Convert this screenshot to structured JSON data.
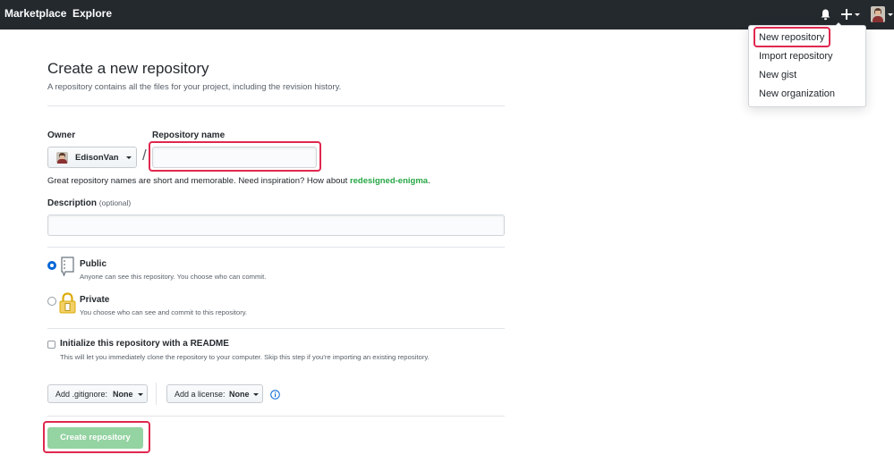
{
  "header": {
    "nav": [
      "Marketplace",
      "Explore"
    ],
    "icons": [
      "bell-icon",
      "plus-icon",
      "avatar"
    ]
  },
  "dropdown": {
    "items": [
      "New repository",
      "Import repository",
      "New gist",
      "New organization"
    ]
  },
  "page": {
    "title": "Create a new repository",
    "subtitle": "A repository contains all the files for your project, including the revision history."
  },
  "form": {
    "owner_label": "Owner",
    "repo_name_label": "Repository name",
    "owner_value": "EdisonVan",
    "slash": "/",
    "repo_name_value": "",
    "hint_prefix": "Great repository names are short and memorable. Need inspiration? How about",
    "hint_suggestion": "redesigned-enigma",
    "hint_suffix": ".",
    "description_label": "Description",
    "description_optional": "(optional)",
    "description_value": "",
    "visibility": [
      {
        "label": "Public",
        "desc": "Anyone can see this repository. You choose who can commit.",
        "selected": true
      },
      {
        "label": "Private",
        "desc": "You choose who can see and commit to this repository.",
        "selected": false
      }
    ],
    "readme_label": "Initialize this repository with a README",
    "readme_desc": "This will let you immediately clone the repository to your computer. Skip this step if you're importing an existing repository.",
    "readme_checked": false,
    "gitignore_prefix": "Add .gitignore:",
    "gitignore_value": "None",
    "license_prefix": "Add a license:",
    "license_value": "None",
    "info_icon": "info-icon",
    "submit_label": "Create repository"
  },
  "colors": {
    "header_bg": "#24292e",
    "highlight": "#e0284f",
    "suggestion": "#28a745",
    "submit_disabled": "#94d3a2",
    "radio_selected": "#0366d6"
  }
}
